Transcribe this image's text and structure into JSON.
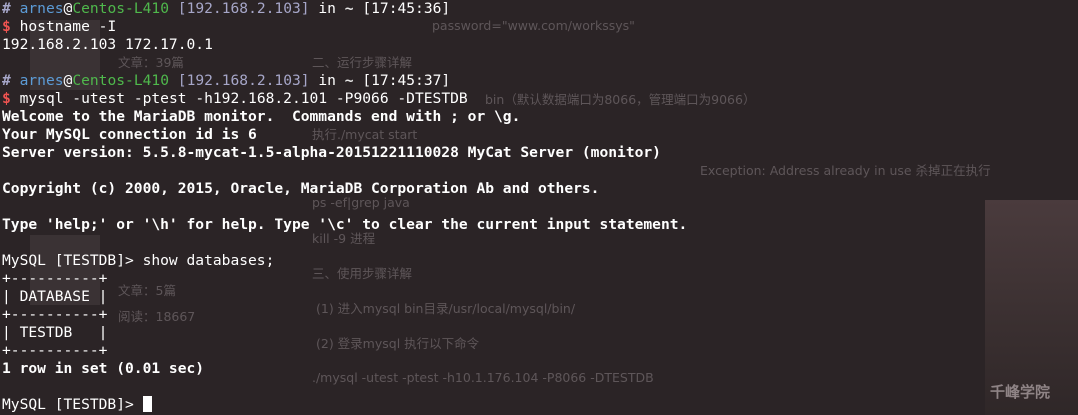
{
  "background_page": {
    "lines": [
      "password=\"www.com/workssys\"",
      "二、运行步骤详解",
      "bin（默认数据端口为8066，管理端口为9066）",
      "执行./mycat start",
      "Exception: Address already in use 杀掉正在执行",
      "ps -ef|grep java",
      "kill -9 进程",
      "三、使用步骤详解",
      "(1) 进入mysql bin目录/usr/local/mysql/bin/",
      "(2) 登录mysql 执行以下命令",
      "./mysql -utest -ptest -h10.1.176.104 -P8066 -DTESTDB",
      "文章：39篇",
      "文章：5篇",
      "阅读：18667"
    ],
    "photo_caption": "千峰学院"
  },
  "terminal": {
    "prompt1": {
      "hash": "#",
      "user": "arnes",
      "at": "@",
      "host": "Centos-L410",
      "dir": "[192.168.2.103]",
      "in": "in",
      "tilde": "~",
      "time": "[17:45:36]"
    },
    "command1": "hostname -I",
    "output1": "192.168.2.103 172.17.0.1",
    "prompt2": {
      "hash": "#",
      "user": "arnes",
      "at": "@",
      "host": "Centos-L410",
      "dir": "[192.168.2.103]",
      "in": "in",
      "tilde": "~",
      "time": "[17:45:37]"
    },
    "command2": "mysql -utest -ptest -h192.168.2.101 -P9066 -DTESTDB",
    "dollar": "$",
    "welcome": [
      "Welcome to the MariaDB monitor.  Commands end with ; or \\g.",
      "Your MySQL connection id is 6",
      "Server version: 5.5.8-mycat-1.5-alpha-20151221110028 MyCat Server (monitor)"
    ],
    "copyright": "Copyright (c) 2000, 2015, Oracle, MariaDB Corporation Ab and others.",
    "help": "Type 'help;' or '\\h' for help. Type '\\c' to clear the current input statement.",
    "query": "MySQL [TESTDB]> show databases;",
    "table": [
      "+----------+",
      "| DATABASE |",
      "+----------+",
      "| TESTDB   |",
      "+----------+"
    ],
    "result": "1 row in set (0.01 sec)",
    "final_prompt": "MySQL [TESTDB]> "
  }
}
